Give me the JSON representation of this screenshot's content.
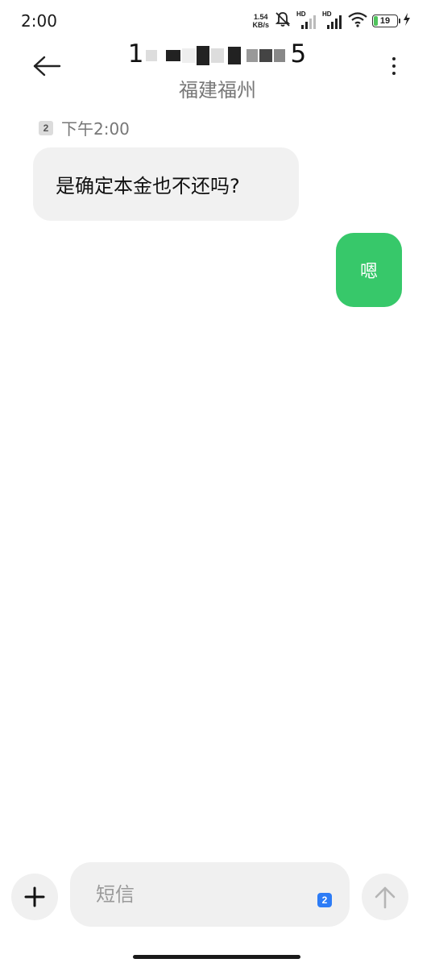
{
  "status_bar": {
    "time": "2:00",
    "net_speed_value": "1.54",
    "net_speed_unit": "KB/s",
    "signal_label_1": "HD",
    "signal_label_2": "HD",
    "battery_level": "19",
    "battery_fraction": 0.19
  },
  "header": {
    "contact_number_first": "1",
    "contact_number_last": "5",
    "contact_location": "福建福州"
  },
  "conversation": {
    "timestamp_sim": "2",
    "timestamp": "下午2:00",
    "messages": [
      {
        "direction": "incoming",
        "text": "是确定本金也不还吗?"
      },
      {
        "direction": "outgoing",
        "text": "嗯"
      }
    ]
  },
  "composer": {
    "placeholder": "短信",
    "sim": "2"
  },
  "colors": {
    "outgoing_bubble": "#37c86a",
    "incoming_bubble": "#f1f1f1",
    "sim_badge_blue": "#2d7cf6",
    "battery_fill": "#4fc35c"
  }
}
